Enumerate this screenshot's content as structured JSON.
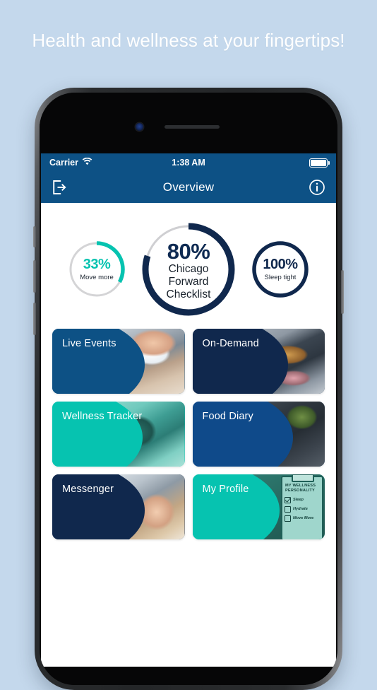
{
  "headline": "Health and wellness at your fingertips!",
  "colors": {
    "page_background": "#c4d8ec",
    "navy": "#10284d",
    "blue": "#0d5185",
    "teal": "#06c3b0",
    "track_gray": "#d4d4d6",
    "white": "#ffffff"
  },
  "status_bar": {
    "carrier": "Carrier",
    "wifi_icon": "wifi-icon",
    "time": "1:38 AM",
    "battery_icon": "battery-full-icon"
  },
  "nav_bar": {
    "logout_icon": "logout-icon",
    "title": "Overview",
    "info_icon": "info-circle-icon"
  },
  "rings": [
    {
      "id": "move-more",
      "percent_label": "33%",
      "percent_value": 33,
      "sub_label": "Move more",
      "arc_color": "#06c3b0",
      "track_color": "#d4d4d6",
      "text_color": "#06c3b0",
      "size": "small"
    },
    {
      "id": "chicago-forward-checklist",
      "percent_label": "80%",
      "percent_value": 80,
      "sub_label": "Chicago\nForward\nChecklist",
      "sub_label_line1": "Chicago",
      "sub_label_line2": "Forward",
      "sub_label_line3": "Checklist",
      "arc_color": "#10284d",
      "track_color": "#d4d4d6",
      "text_color": "#10284d",
      "size": "big"
    },
    {
      "id": "sleep-tight",
      "percent_label": "100%",
      "percent_value": 100,
      "sub_label": "Sleep tight",
      "arc_color": "#10284d",
      "track_color": "#10284d",
      "text_color": "#10284d",
      "size": "small"
    }
  ],
  "cards": [
    {
      "id": "live-events",
      "title": "Live Events",
      "bg": "#0d5185",
      "photo": "ph-live"
    },
    {
      "id": "on-demand",
      "title": "On-Demand",
      "bg": "#10284d",
      "photo": "ph-ondemand"
    },
    {
      "id": "wellness-tracker",
      "title": "Wellness Tracker",
      "bg": "#06c3b0",
      "photo": "ph-wellness"
    },
    {
      "id": "food-diary",
      "title": "Food Diary",
      "bg": "#0f4a8a",
      "photo": "ph-food"
    },
    {
      "id": "messenger",
      "title": "Messenger",
      "bg": "#10284d",
      "photo": "ph-messenger"
    },
    {
      "id": "my-profile",
      "title": "My Profile",
      "bg": "#06c3b0",
      "photo": "ph-profile"
    }
  ],
  "profile_clipboard": {
    "heading_line1": "MY WELLNESS",
    "heading_line2": "PERSONALITY",
    "items": [
      {
        "label": "Sleep",
        "checked": true
      },
      {
        "label": "Hydrate",
        "checked": false
      },
      {
        "label": "Move More",
        "checked": false
      }
    ]
  }
}
